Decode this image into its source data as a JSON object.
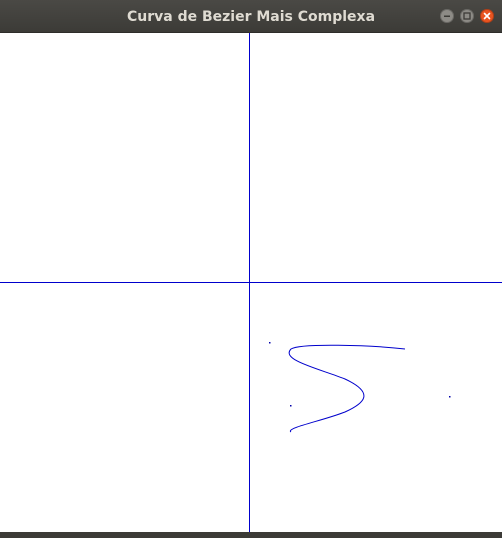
{
  "window": {
    "title": "Curva de Bezier Mais Complexa",
    "controls": [
      "minimize",
      "maximize",
      "close"
    ]
  },
  "colors": {
    "titlebar": "#3c3b37",
    "title_text": "#dfdbd2",
    "close_button": "#e95420",
    "window_button": "#8d8b86",
    "canvas_background": "#ffffff",
    "axes": "#0000cc",
    "curve": "#0000cc",
    "control_points": "#0000aa"
  },
  "icons": {
    "minimize": "minimize-icon",
    "maximize": "maximize-icon",
    "close": "close-icon"
  }
}
